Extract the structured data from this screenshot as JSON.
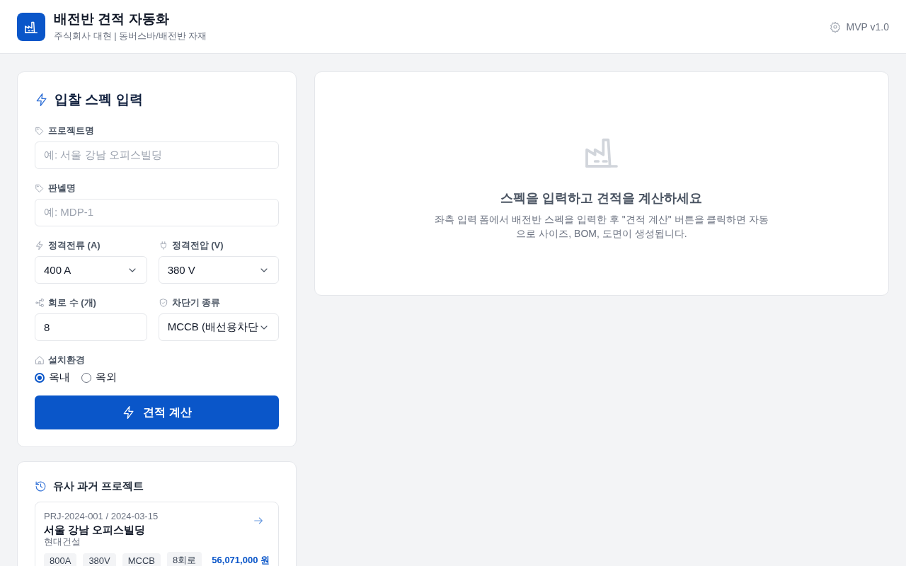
{
  "header": {
    "title": "배전반 견적 자동화",
    "subtitle": "주식회사 대현 | 동버스바/배전반 자재",
    "version": "MVP v1.0"
  },
  "spec_form": {
    "title": "입찰 스펙 입력",
    "fields": [
      {
        "kind": "text",
        "label": "프로젝트명",
        "placeholder": "예: 서울 강남 오피스빌딩"
      },
      {
        "kind": "text",
        "label": "판넬명",
        "placeholder": "예: MDP-1"
      },
      {
        "kind": "select",
        "label": "정격전류 (A)",
        "value": "400 A"
      },
      {
        "kind": "select",
        "label": "정격전압 (V)",
        "value": "380 V"
      },
      {
        "kind": "number",
        "label": "회로 수 (개)",
        "value": "8"
      },
      {
        "kind": "select",
        "label": "차단기 종류",
        "value": "MCCB (배선용차단"
      },
      {
        "kind": "radio",
        "label": "설치환경",
        "options": [
          {
            "label": "옥내",
            "selected": true
          },
          {
            "label": "옥외",
            "selected": false
          }
        ]
      }
    ],
    "submit": "견적 계산"
  },
  "history": {
    "title": "유사 과거 프로젝트",
    "projects": [
      {
        "meta": "PRJ-2024-001 / 2024-03-15",
        "name": "서울 강남 오피스빌딩",
        "client": "현대건설",
        "tags": [
          "800A",
          "380V",
          "MCCB",
          "8회로"
        ],
        "price": "56,071,000 원"
      }
    ]
  },
  "empty_state": {
    "title": "스펙을 입력하고 견적을 계산하세요",
    "message": "좌측 입력 폼에서 배전반 스펙을 입력한 후 \"견적 계산\" 버튼을 클릭하면 자동으로 사이즈, BOM, 도면이 생성됩니다."
  }
}
